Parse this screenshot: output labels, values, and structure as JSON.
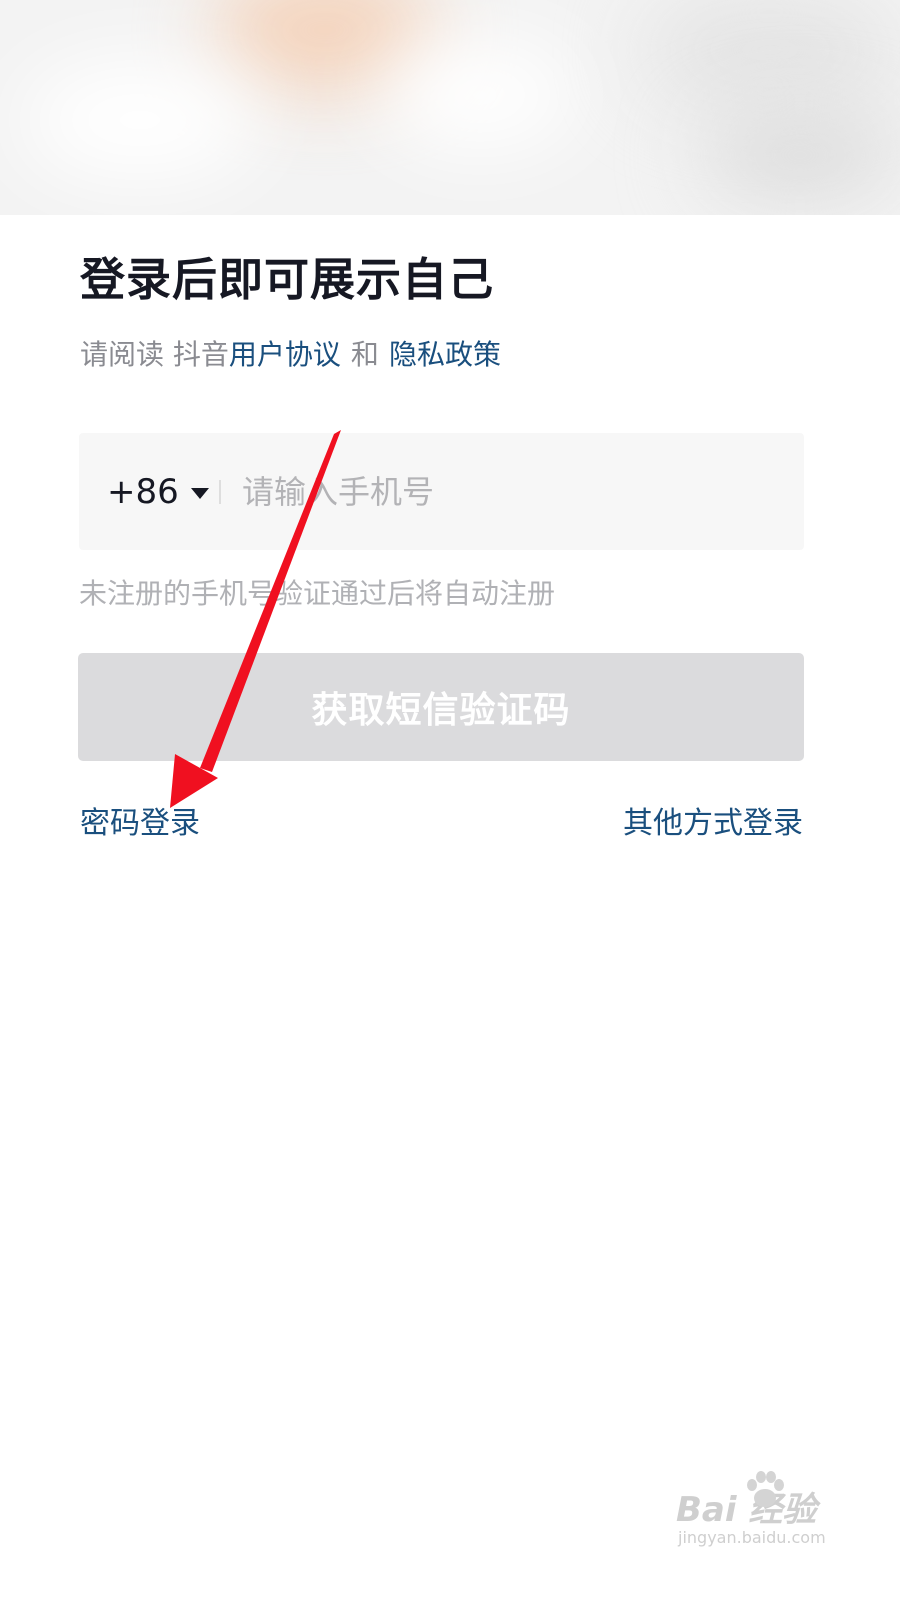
{
  "header": {
    "title": "登录后即可展示自己"
  },
  "agreement": {
    "prefix": "请阅读 抖音",
    "user_agreement": "用户协议",
    "conjunction": "和",
    "privacy_policy": "隐私政策"
  },
  "phone": {
    "country_code": "+86",
    "placeholder": "请输入手机号",
    "value": ""
  },
  "hint": "未注册的手机号验证通过后将自动注册",
  "sms_button": {
    "label": "获取短信验证码",
    "enabled": false
  },
  "links": {
    "password_login": "密码登录",
    "other_login": "其他方式登录"
  },
  "watermark": {
    "brand": "Bai  经验",
    "url": "jingyan.baidu.com"
  },
  "colors": {
    "title": "#161823",
    "link": "#1a4f7e",
    "muted": "#8a8b91",
    "button_disabled": "#dbdbdd",
    "annotation_arrow": "#f01020"
  },
  "icons": {
    "country_dropdown": "caret-down-icon",
    "annotation": "red-arrow-annotation"
  }
}
